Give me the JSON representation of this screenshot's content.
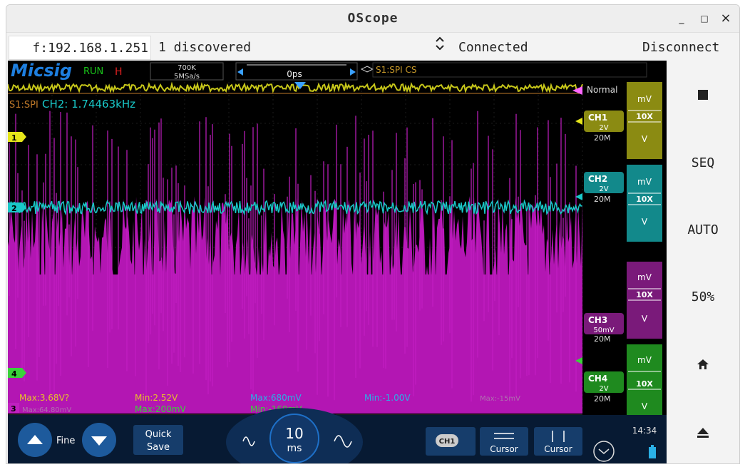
{
  "window": {
    "title": "OScope",
    "minimize": "_",
    "maximize": "□",
    "close": "×"
  },
  "toolbar": {
    "ip": "f:192.168.1.251",
    "discovered": "1 discovered",
    "status": "Connected",
    "disconnect": "Disconnect"
  },
  "scope": {
    "logo": "Micsig",
    "run": "RUN",
    "h": "H",
    "mem_depth": "700K",
    "sample_rate": "5MSa/s",
    "trigger_pos": "0ps",
    "trigger_source": "S1:SPI CS",
    "bus_label": "S1:SPI",
    "freq_readout": "CH2: 1.74463kHz",
    "trigger_mode": "Normal",
    "channels": [
      {
        "name": "CH1",
        "scale": "2V",
        "bw": "20M",
        "unit": "mV",
        "probe": "10X",
        "unit2": "V",
        "color": "#8b8b12"
      },
      {
        "name": "CH2",
        "scale": "2V",
        "bw": "20M",
        "unit": "mV",
        "probe": "10X",
        "unit2": "V",
        "color": "#12898b"
      },
      {
        "name": "CH3",
        "scale": "50mV",
        "bw": "20M",
        "unit": "mV",
        "probe": "10X",
        "unit2": "V",
        "color": "#7a1a7a"
      },
      {
        "name": "CH4",
        "scale": "2V",
        "bw": "20M",
        "unit": "mV",
        "probe": "10X",
        "unit2": "V",
        "color": "#1f8a1f"
      }
    ],
    "markers": [
      "1",
      "2",
      "4",
      "3"
    ],
    "measurements": {
      "ch1_max": "Max:3.68V?",
      "ch1_min": "Min:2.52V",
      "ch2_max": "Max:680mV",
      "ch2_min": "Min:-1.00V",
      "ch3_extra": "Max:-15mV",
      "ch4_max": "Max:200mV",
      "ch4_min": "Min:-160mV",
      "ch3_row2": "Max:64.80mV"
    },
    "bottom": {
      "fine": "Fine",
      "quick_save_1": "Quick",
      "quick_save_2": "Save",
      "timebase_value": "10",
      "timebase_unit": "ms",
      "ch_button": "CH1",
      "cursor1": "Cursor",
      "cursor2": "Cursor",
      "time": "14:34"
    }
  },
  "side": {
    "seq": "SEQ",
    "auto": "AUTO",
    "fifty": "50%"
  }
}
